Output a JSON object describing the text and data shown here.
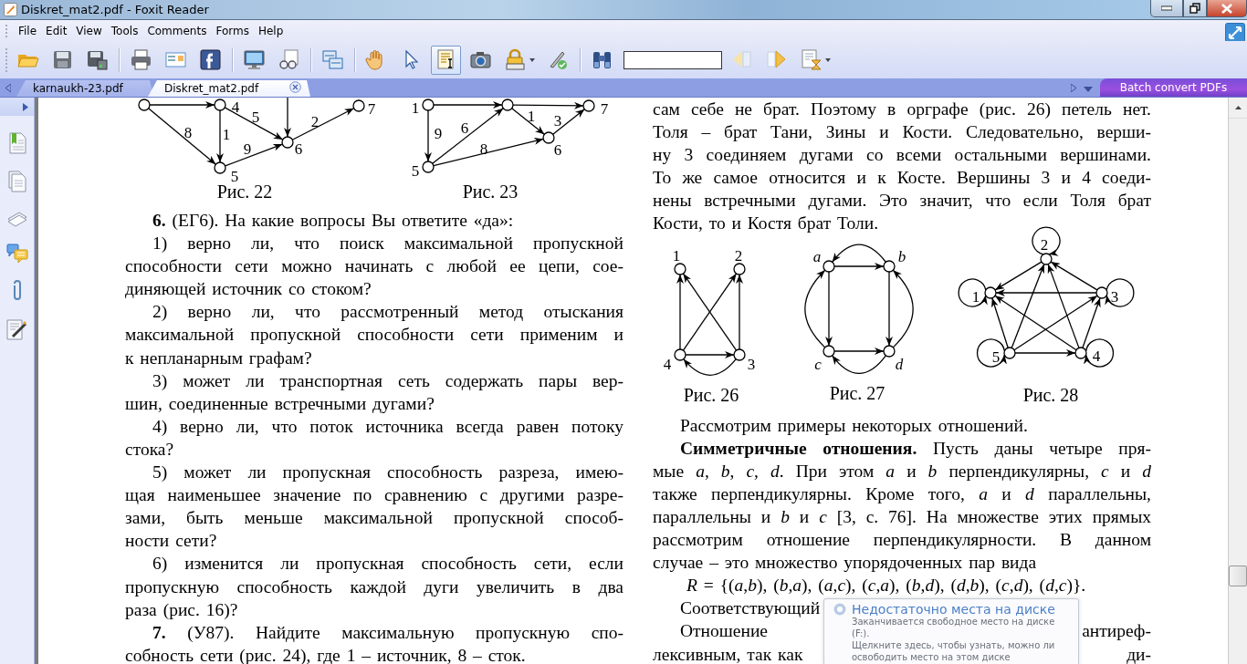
{
  "window": {
    "title": "Diskret_mat2.pdf - Foxit Reader"
  },
  "menu": [
    {
      "label": "File"
    },
    {
      "label": "Edit"
    },
    {
      "label": "View"
    },
    {
      "label": "Tools"
    },
    {
      "label": "Comments"
    },
    {
      "label": "Forms"
    },
    {
      "label": "Help"
    }
  ],
  "toolbar": [
    {
      "buttons": [
        {
          "kind": "open",
          "selected": false
        },
        {
          "kind": "save",
          "selected": false
        },
        {
          "kind": "saveas",
          "selected": false
        }
      ]
    },
    {
      "buttons": [
        {
          "kind": "print",
          "selected": false
        },
        {
          "kind": "email",
          "selected": false
        },
        {
          "kind": "facebook",
          "selected": false
        }
      ]
    },
    {
      "buttons": [
        {
          "kind": "present",
          "selected": false
        },
        {
          "kind": "review",
          "selected": false
        }
      ]
    },
    {
      "buttons": [
        {
          "kind": "convert",
          "selected": false
        }
      ]
    },
    {
      "buttons": [
        {
          "kind": "hand",
          "selected": false
        },
        {
          "kind": "select",
          "selected": false
        },
        {
          "kind": "textselect",
          "selected": true
        },
        {
          "kind": "snapshot",
          "selected": false
        },
        {
          "kind": "rms",
          "selected": false
        },
        {
          "kind": "sign",
          "selected": false
        }
      ]
    },
    {
      "buttons": [
        {
          "kind": "find",
          "selected": false
        },
        {
          "kind": "search",
          "selected": false
        },
        {
          "kind": "prev",
          "selected": false
        },
        {
          "kind": "next",
          "selected": false
        },
        {
          "kind": "timer",
          "selected": false
        }
      ]
    }
  ],
  "tabs": [
    {
      "label": "karnaukh-23.pdf",
      "selected": false
    },
    {
      "label": "Diskret_mat2.pdf",
      "selected": true
    }
  ],
  "batch_button": {
    "label": "Batch convert PDFs"
  },
  "document": {
    "left_column": [
      {
        "kind": "figures",
        "items": [
          {
            "caption": "Рис. 22",
            "labels": [
              "4",
              "6",
              "5",
              "7",
              "8",
              "1",
              "5",
              "9",
              "2"
            ]
          },
          {
            "caption": "Рис. 23",
            "labels": [
              "1",
              "7",
              "6",
              "5",
              "9",
              "6",
              "1",
              "3",
              "8"
            ]
          }
        ]
      },
      {
        "kind": "lines",
        "items": [
          {
            "kind": "single",
            "text": "**6.** (ЕГ6). На какие вопросы Вы ответите «да»:"
          },
          {
            "kind": "first",
            "text": "1) верно ли, что поиск максимальной пропускной"
          },
          {
            "kind": "body",
            "text": "способности сети можно начинать с любой ее цепи, сое-"
          },
          {
            "kind": "last",
            "text": "диняющей источник со стоком?"
          },
          {
            "kind": "first",
            "text": "2) верно ли, что рассмотренный метод отыскания"
          },
          {
            "kind": "body",
            "text": "максимальной пропускной способности сети применим и"
          },
          {
            "kind": "last",
            "text": "к непланарным графам?"
          },
          {
            "kind": "first",
            "text": "3) может ли транспортная сеть содержать пары вер-"
          },
          {
            "kind": "last",
            "text": "шин, соединенные встречными дугами?"
          },
          {
            "kind": "first",
            "text": "4) верно ли, что поток источника всегда равен потоку"
          },
          {
            "kind": "last",
            "text": "стока?"
          },
          {
            "kind": "first",
            "text": "5) может ли пропускная способность разреза, имею-"
          },
          {
            "kind": "body",
            "text": "щая наименьшее значение по сравнению с другими разре-"
          },
          {
            "kind": "body",
            "text": "зами, быть меньше максимальной пропускной способ-"
          },
          {
            "kind": "last",
            "text": "ности сети?"
          },
          {
            "kind": "first",
            "text": "6) изменится ли пропускная способность сети, если"
          },
          {
            "kind": "body",
            "text": "пропускную способность каждой дуги увеличить в два"
          },
          {
            "kind": "last",
            "text": "раза (рис. 16)?"
          },
          {
            "kind": "first",
            "text": "**7.** (У87). Найдите максимальную пропускную спо-"
          },
          {
            "kind": "last",
            "text": "собность сети (рис. 24), где 1 – источник, 8 – сток."
          }
        ]
      }
    ],
    "right_column": [
      {
        "kind": "lines",
        "items": [
          {
            "kind": "body",
            "text": "сам себе не брат. Поэтому в орграфе (рис. 26) петель нет."
          },
          {
            "kind": "body",
            "text": "Толя – брат Тани, Зины и Кости. Следовательно, верши-"
          },
          {
            "kind": "body",
            "text": "ну 3 соединяем дугами со всеми остальными вершинами."
          },
          {
            "kind": "body",
            "text": "То же самое относится и к Косте. Вершины 3 и 4 соеди-"
          },
          {
            "kind": "body",
            "text": "нены встречными дугами. Это значит, что если Толя брат"
          },
          {
            "kind": "last",
            "text": "Кости, то и Костя брат Толи."
          }
        ]
      },
      {
        "kind": "figures",
        "items": [
          {
            "caption": "Рис. 26",
            "labels": [
              "1",
              "2",
              "4",
              "3"
            ]
          },
          {
            "caption": "Рис. 27",
            "labels": [
              "a",
              "b",
              "c",
              "d"
            ]
          },
          {
            "caption": "Рис. 28",
            "labels": [
              "2",
              "1",
              "3",
              "5",
              "4"
            ]
          }
        ]
      },
      {
        "kind": "lines",
        "items": [
          {
            "kind": "single",
            "text": "Рассмотрим примеры некоторых отношений."
          },
          {
            "kind": "first",
            "text": "**Симметричные отношения.** Пусть даны четыре пря-"
          },
          {
            "kind": "body",
            "text": "мые *a*, *b*, *c*, *d*. При этом *a* и *b* перпендикулярны, *c* и *d*"
          },
          {
            "kind": "body",
            "text": "также перпендикулярны. Кроме того, *a* и *d* параллельны,"
          },
          {
            "kind": "body",
            "text": "параллельны и *b* и *c* [3, с. 76]. На множестве этих прямых"
          },
          {
            "kind": "body",
            "text": "рассмотрим отношение перпендикулярности. В данном"
          },
          {
            "kind": "last",
            "text": "случае – это множество упорядоченных пар вида"
          },
          {
            "kind": "formula",
            "text": "*R* = {(*a*,*b*), (*b*,*a*), (*a*,*c*), (*c*,*a*), (*b*,*d*), (*d*,*b*), (*c*,*d*), (*d*,*c*)}."
          },
          {
            "kind": "coveredindent",
            "parts": [
              "Соответствующий"
            ]
          },
          {
            "kind": "coveredindent",
            "parts": [
              "Отношение",
              "антиреф-"
            ]
          },
          {
            "kind": "covered",
            "parts": [
              "лексивным, так как",
              "ди-"
            ]
          }
        ]
      }
    ]
  },
  "notification": {
    "title": "Недостаточно места на диске",
    "body": [
      "Заканчивается свободное место на диске (F:).",
      "Щелкните здесь, чтобы узнать, можно ли освободить место на этом диске"
    ]
  }
}
